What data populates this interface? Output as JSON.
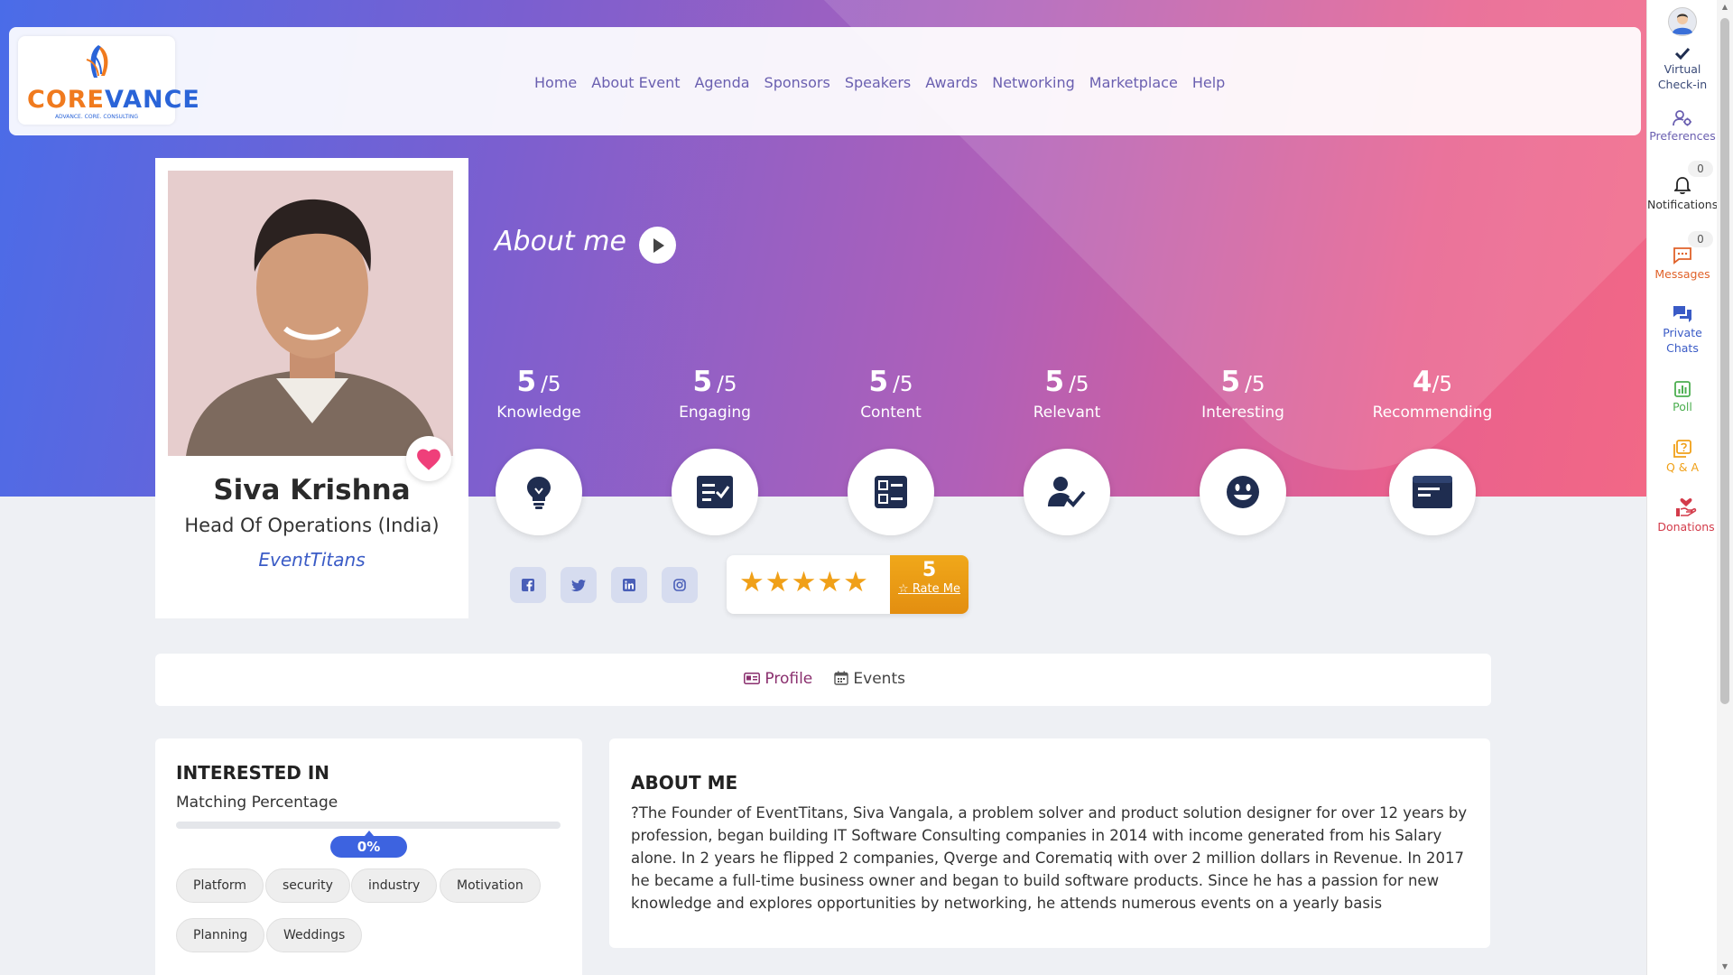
{
  "brand": {
    "logo_text_left": "CORE",
    "logo_text_right": "VANCE",
    "logo_tagline": "ADVANCE. CORE. CONSULTING"
  },
  "nav": {
    "items": [
      "Home",
      "About Event",
      "Agenda",
      "Sponsors",
      "Speakers",
      "Awards",
      "Networking",
      "Marketplace",
      "Help"
    ]
  },
  "profile": {
    "name": "Siva Krishna",
    "title": "Head Of Operations (India)",
    "company": "EventTitans"
  },
  "about_heading": "About me",
  "ratings": [
    {
      "score": "5",
      "outof": "/5",
      "label": "Knowledge",
      "icon": "lightbulb-icon"
    },
    {
      "score": "5",
      "outof": "/5",
      "label": "Engaging",
      "icon": "checklist-icon"
    },
    {
      "score": "5",
      "outof": "/5",
      "label": "Content",
      "icon": "list-view-icon"
    },
    {
      "score": "5",
      "outof": "/5",
      "label": "Relevant",
      "icon": "user-check-icon"
    },
    {
      "score": "5",
      "outof": "/5",
      "label": "Interesting",
      "icon": "smile-icon"
    },
    {
      "score": "4",
      "outof": "/5",
      "label": "Recommending",
      "icon": "browser-window-icon"
    }
  ],
  "social": [
    "facebook-icon",
    "twitter-icon",
    "linkedin-icon",
    "instagram-icon"
  ],
  "overall_rating": {
    "stars": "★★★★★",
    "value": "5",
    "rate_label": "Rate Me",
    "color": "#f0a018"
  },
  "tabs": {
    "profile": "Profile",
    "events": "Events"
  },
  "interests": {
    "title": "INTERESTED IN",
    "subtitle": "Matching Percentage",
    "percent_label": "0%",
    "percent_value": 0,
    "chips": [
      "Platform",
      "security",
      "industry",
      "Motivation",
      "Planning",
      "Weddings"
    ]
  },
  "about": {
    "title": "ABOUT ME",
    "text": "?The Founder of EventTitans, Siva Vangala, a problem solver and product solution designer for over 12 years by profession, began building IT Software Consulting companies in 2014 with income generated from his Salary alone. In 2 years he flipped 2 companies, Qverge and Corematiq with over 2 million dollars in Revenue. In 2017 he became a full-time business owner and began to build software products. Since he has a passion for new knowledge and explores opportunities by networking, he attends numerous events on a yearly basis"
  },
  "sidebar": {
    "checkin": "Virtual Check-in",
    "preferences": "Preferences",
    "notifications": "Notifications",
    "notifications_count": "0",
    "messages": "Messages",
    "messages_count": "0",
    "private_chats": "Private Chats",
    "poll": "Poll",
    "qa": "Q & A",
    "donations": "Donations"
  },
  "colors": {
    "accent_blue": "#3d63e0",
    "heart": "#ef3f7a",
    "messages": "#e0622a",
    "poll": "#4caf50",
    "qa": "#f0a018",
    "donations": "#d33b4a",
    "nav_text": "#6a5fb0"
  }
}
